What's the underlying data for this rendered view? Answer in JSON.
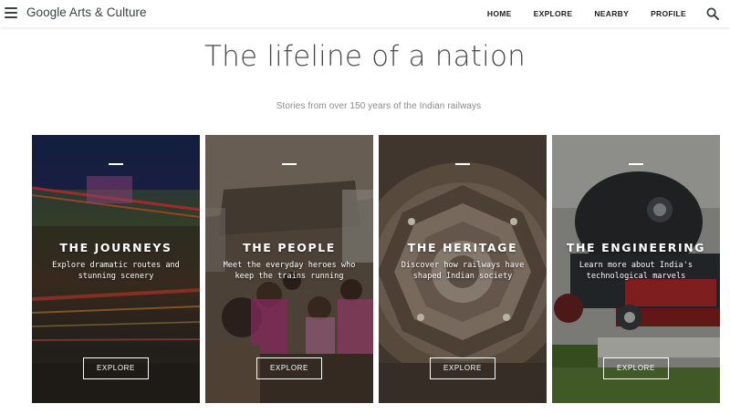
{
  "header": {
    "logo": "Google Arts & Culture",
    "nav": [
      "HOME",
      "EXPLORE",
      "NEARBY",
      "PROFILE"
    ],
    "icons": {
      "menu": "hamburger-menu-icon",
      "search": "search-icon"
    }
  },
  "hero": {
    "title": "The lifeline of a nation",
    "subtitle": "Stories from over 150 years of the Indian railways"
  },
  "cards": [
    {
      "title": "THE JOURNEYS",
      "description": "Explore dramatic routes and stunning scenery",
      "button": "EXPLORE"
    },
    {
      "title": "THE PEOPLE",
      "description": "Meet the everyday heroes who keep the trains running",
      "button": "EXPLORE"
    },
    {
      "title": "THE HERITAGE",
      "description": "Discover how railways have shaped Indian society",
      "button": "EXPLORE"
    },
    {
      "title": "THE ENGINEERING",
      "description": "Learn more about India's technological marvels",
      "button": "EXPLORE"
    }
  ],
  "colors": {
    "header_text": "#202124",
    "title": "#4a4a4a",
    "subtitle": "#8a8a8a"
  }
}
